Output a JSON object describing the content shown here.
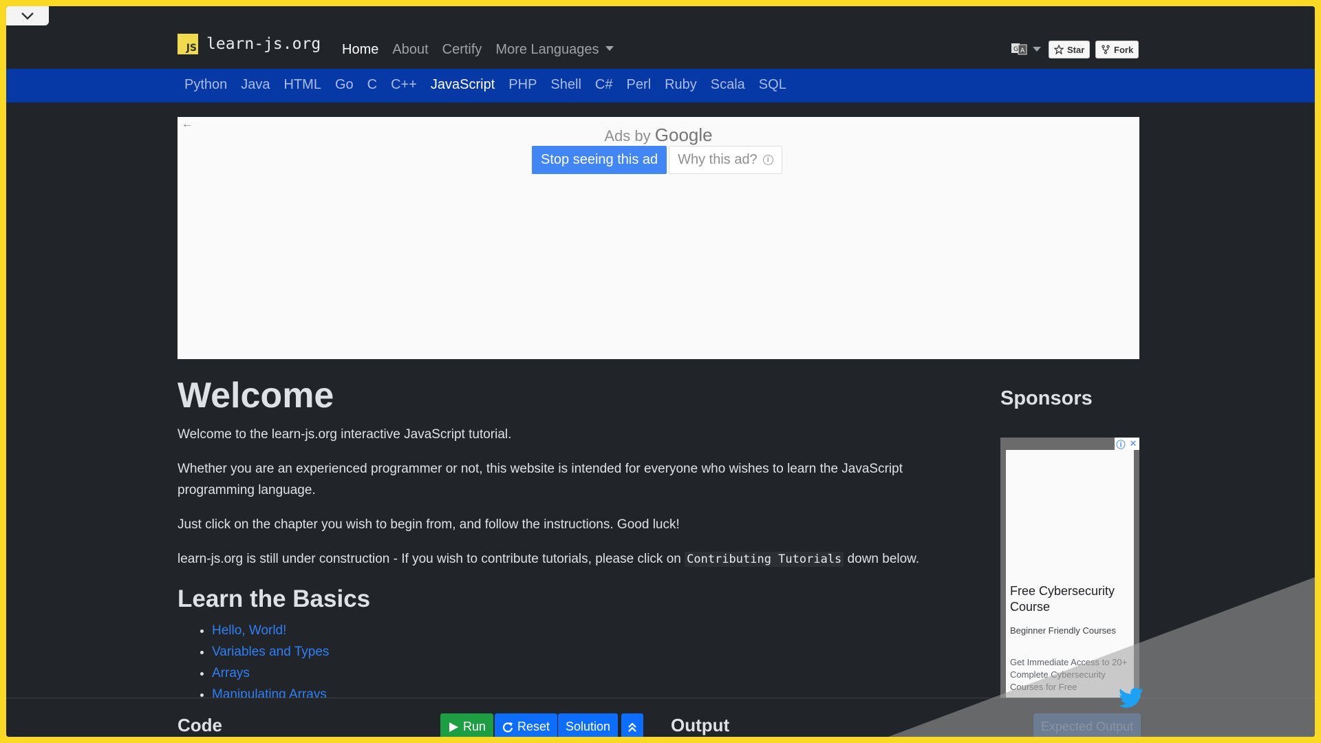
{
  "brand": {
    "name": "learn-js.org",
    "logo_text": "JS"
  },
  "nav": {
    "items": [
      {
        "label": "Home",
        "active": true
      },
      {
        "label": "About",
        "active": false
      },
      {
        "label": "Certify",
        "active": false
      },
      {
        "label": "More Languages",
        "active": false
      }
    ]
  },
  "github": {
    "star_label": "Star",
    "fork_label": "Fork"
  },
  "languages": [
    {
      "label": "Python"
    },
    {
      "label": "Java"
    },
    {
      "label": "HTML"
    },
    {
      "label": "Go"
    },
    {
      "label": "C"
    },
    {
      "label": "C++"
    },
    {
      "label": "JavaScript",
      "active": true
    },
    {
      "label": "PHP"
    },
    {
      "label": "Shell"
    },
    {
      "label": "C#"
    },
    {
      "label": "Perl"
    },
    {
      "label": "Ruby"
    },
    {
      "label": "Scala"
    },
    {
      "label": "SQL"
    }
  ],
  "ad": {
    "ads_by": "Ads by",
    "google": "Google",
    "stop_label": "Stop seeing this ad",
    "why_label": "Why this ad?",
    "back_arrow": "←"
  },
  "content": {
    "title": "Welcome",
    "p1": "Welcome to the learn-js.org interactive JavaScript tutorial.",
    "p2": "Whether you are an experienced programmer or not, this website is intended for everyone who wishes to learn the JavaScript programming language.",
    "p3": "Just click on the chapter you wish to begin from, and follow the instructions. Good luck!",
    "p4_before": "learn-js.org is still under construction - If you wish to contribute tutorials, please click on",
    "p4_code": "Contributing Tutorials",
    "p4_after": "down below.",
    "section_title": "Learn the Basics",
    "lessons": [
      "Hello, World!",
      "Variables and Types",
      "Arrays",
      "Manipulating Arrays"
    ]
  },
  "sponsors": {
    "title": "Sponsors",
    "ad_title": "Free Cybersecurity Course",
    "ad_subtitle": "Beginner Friendly Courses",
    "ad_desc": "Get Immediate Access to 20+ Complete Cybersecurity Courses for Free"
  },
  "bottom": {
    "code_label": "Code",
    "run_label": "Run",
    "reset_label": "Reset",
    "solution_label": "Solution",
    "output_label": "Output",
    "expected_label": "Expected Output"
  },
  "colors": {
    "frame_border": "#f9d923",
    "lang_bar": "#0639a6",
    "run_green": "#1e9e43",
    "primary_blue": "#0d6efd",
    "link_blue": "#2f7ff5"
  }
}
